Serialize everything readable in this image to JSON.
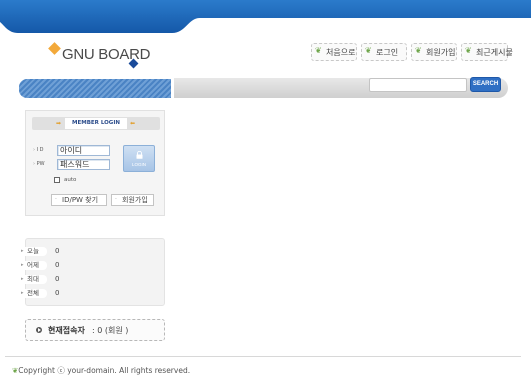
{
  "logo": {
    "text": "GNU BOARD"
  },
  "nav": {
    "home": "처음으로",
    "login": "로그인",
    "join": "회원가입",
    "recent": "최근게시물"
  },
  "search": {
    "value": "",
    "button": "SEARCH"
  },
  "login": {
    "header": "MEMBER LOGIN",
    "id_label": "I D",
    "pw_label": "PW",
    "id_value": "아이디",
    "pw_value": "패스워드",
    "login_button": "LOGIN",
    "auto_label": "auto",
    "find_button": "ID/PW 찾기",
    "join_button": "회원가입"
  },
  "stats": [
    {
      "label": "오늘",
      "value": "0"
    },
    {
      "label": "어제",
      "value": "0"
    },
    {
      "label": "최대",
      "value": "0"
    },
    {
      "label": "전체",
      "value": "0"
    }
  ],
  "current": {
    "label": "현재접속자",
    "value": ": 0 (회원 )"
  },
  "footer": {
    "text": "Copyright ⓒ your-domain. All rights reserved."
  },
  "colors": {
    "header_blue": "#1b63b5",
    "accent": "#2f6fc4"
  }
}
